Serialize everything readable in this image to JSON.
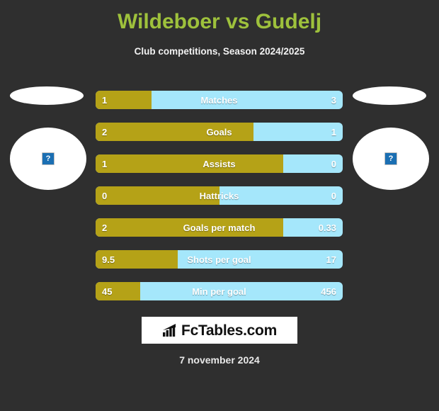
{
  "header": {
    "title": "Wildeboer vs Gudelj",
    "subtitle": "Club competitions, Season 2024/2025",
    "title_color": "#9ec13c",
    "subtitle_color": "#f2f2f2"
  },
  "theme": {
    "background": "#2f2f2f",
    "home_bar_color": "#b5a217",
    "away_bar_color": "#a5e7fb",
    "text_color": "#ffffff"
  },
  "players": {
    "left": {
      "photo_placeholder_icon": "broken-image-icon",
      "photo_placeholder_glyph": "?"
    },
    "right": {
      "photo_placeholder_icon": "broken-image-icon",
      "photo_placeholder_glyph": "?"
    }
  },
  "chart_data": {
    "type": "bar",
    "title": "Wildeboer vs Gudelj",
    "subtitle": "Club competitions, Season 2024/2025",
    "orientation": "horizontal-diverging",
    "series": [
      {
        "name": "Wildeboer",
        "color": "#b5a217",
        "values": [
          1,
          2,
          1,
          0,
          2,
          9.5,
          45
        ]
      },
      {
        "name": "Gudelj",
        "color": "#a5e7fb",
        "values": [
          3,
          1,
          0,
          0,
          0.33,
          17,
          456
        ]
      }
    ],
    "categories": [
      "Matches",
      "Goals",
      "Assists",
      "Hattricks",
      "Goals per match",
      "Shots per goal",
      "Min per goal"
    ],
    "rows": [
      {
        "label": "Matches",
        "home": "1",
        "away": "3",
        "home_pct": 22.6
      },
      {
        "label": "Goals",
        "home": "2",
        "away": "1",
        "home_pct": 64.0
      },
      {
        "label": "Assists",
        "home": "1",
        "away": "0",
        "home_pct": 76.0
      },
      {
        "label": "Hattricks",
        "home": "0",
        "away": "0",
        "home_pct": 50.0
      },
      {
        "label": "Goals per match",
        "home": "2",
        "away": "0.33",
        "home_pct": 76.0
      },
      {
        "label": "Shots per goal",
        "home": "9.5",
        "away": "17",
        "home_pct": 33.2
      },
      {
        "label": "Min per goal",
        "home": "45",
        "away": "456",
        "home_pct": 18.0
      }
    ],
    "grid": false,
    "legend": "none"
  },
  "footer": {
    "logo_text": "FcTables.com",
    "logo_icon": "bar-chart-icon",
    "date": "7 november 2024"
  }
}
